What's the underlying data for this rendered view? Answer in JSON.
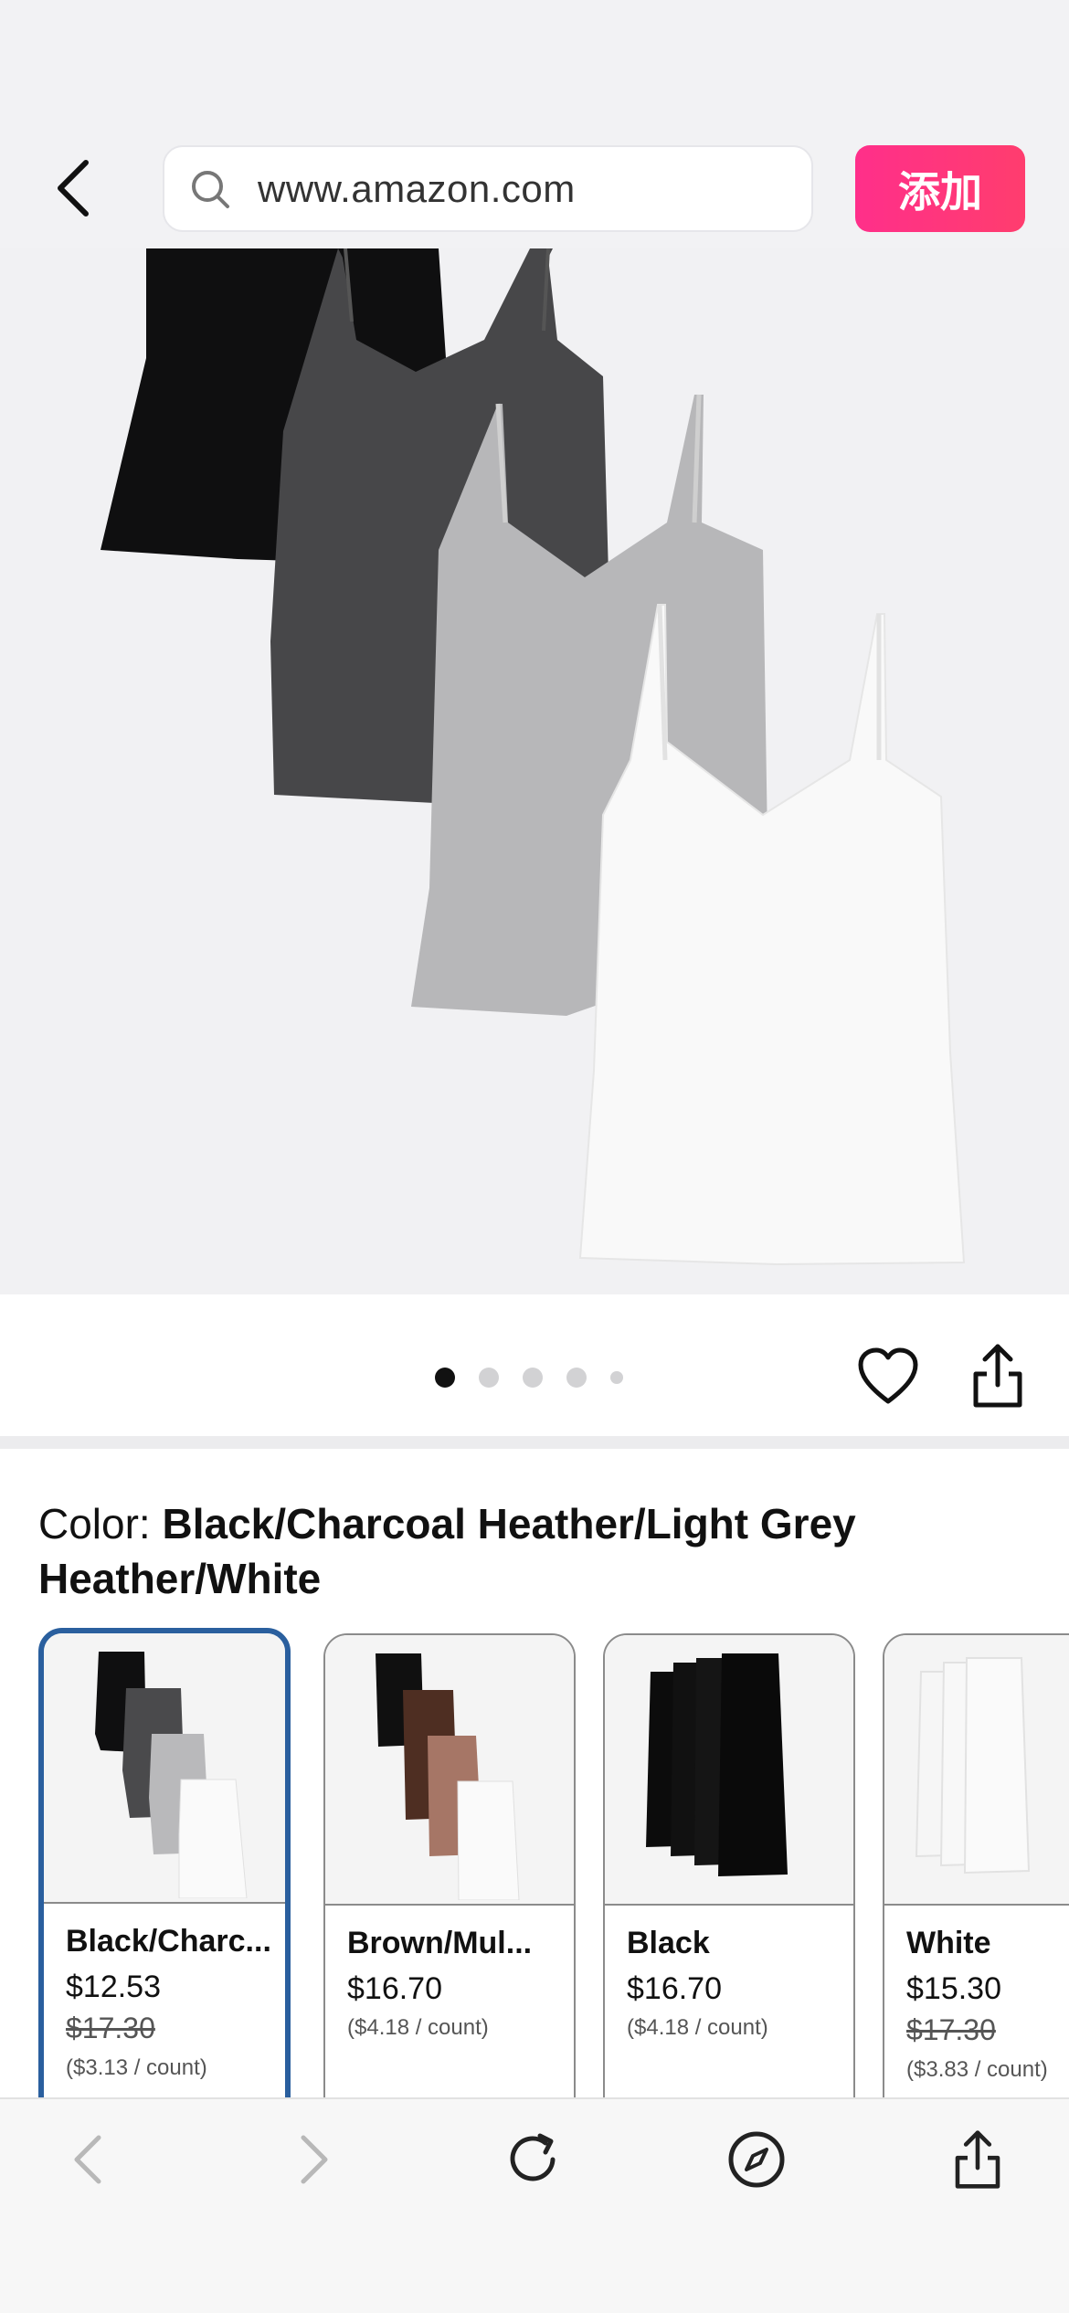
{
  "browser": {
    "url": "www.amazon.com",
    "add_button_label": "添加"
  },
  "gallery": {
    "image_count": 5,
    "active_index": 0
  },
  "product": {
    "color_prefix": "Color: ",
    "color_value": "Black/Charcoal Heather/Light Grey Heather/White"
  },
  "swatches": [
    {
      "name": "Black/Charc...",
      "price": "$12.53",
      "was": "$17.30",
      "unit": "($3.13 / count)"
    },
    {
      "name": "Brown/Mul...",
      "price": "$16.70",
      "was": "",
      "unit": "($4.18 / count)"
    },
    {
      "name": "Black",
      "price": "$16.70",
      "was": "",
      "unit": "($4.18 / count)"
    },
    {
      "name": "White",
      "price": "$15.30",
      "was": "$17.30",
      "unit": "($3.83 / count)"
    }
  ],
  "icons": {
    "back": "chevron-left-icon",
    "search": "search-icon",
    "heart": "heart-icon",
    "share": "share-icon",
    "nav_back": "chevron-left-icon",
    "nav_forward": "chevron-right-icon",
    "reload": "reload-icon",
    "compass": "compass-icon"
  },
  "colors": {
    "add_button": "#ff2f8a",
    "selected_border": "#2a5f9e"
  }
}
